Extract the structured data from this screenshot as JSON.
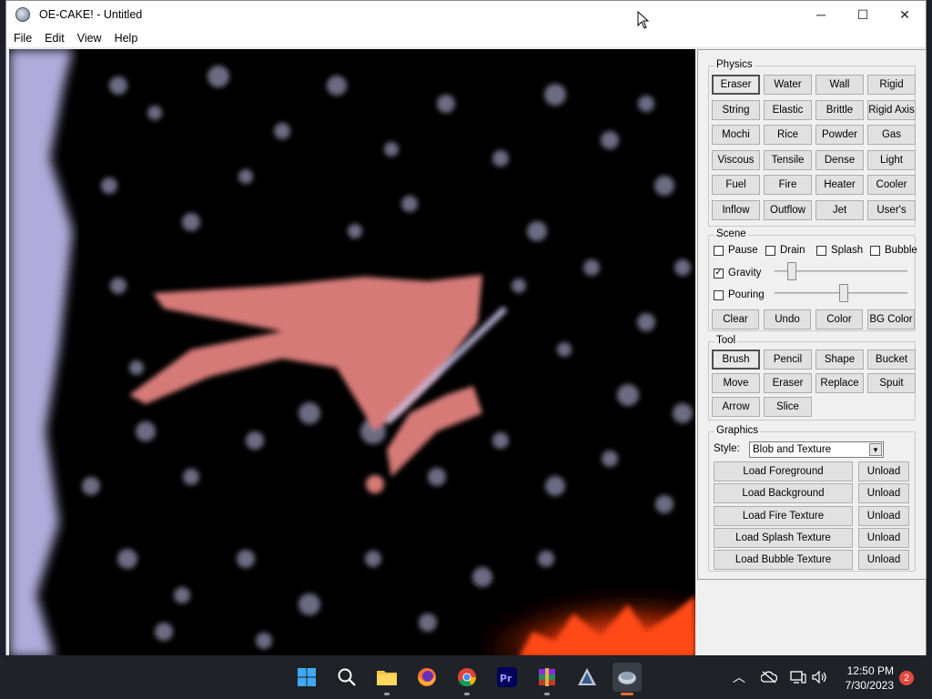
{
  "window": {
    "title": "OE-CAKE! - Untitled"
  },
  "menu": [
    "File",
    "Edit",
    "View",
    "Help"
  ],
  "physics": {
    "title": "Physics",
    "buttons": [
      "Eraser",
      "Water",
      "Wall",
      "Rigid",
      "String",
      "Elastic",
      "Brittle",
      "Rigid Axis",
      "Mochi",
      "Rice",
      "Powder",
      "Gas",
      "Viscous",
      "Tensile",
      "Dense",
      "Light",
      "Fuel",
      "Fire",
      "Heater",
      "Cooler",
      "Inflow",
      "Outflow",
      "Jet",
      "User's"
    ],
    "selected": "Eraser"
  },
  "scene": {
    "title": "Scene",
    "checks": {
      "pause": "Pause",
      "drain": "Drain",
      "splash": "Splash",
      "bubble": "Bubble"
    },
    "gravity": {
      "label": "Gravity",
      "checked": true,
      "level": 0.1
    },
    "pouring": {
      "label": "Pouring",
      "checked": false,
      "level": 0.52
    },
    "buttons": [
      "Clear",
      "Undo",
      "Color",
      "BG Color"
    ]
  },
  "tool": {
    "title": "Tool",
    "buttons": [
      "Brush",
      "Pencil",
      "Shape",
      "Bucket",
      "Move",
      "Eraser",
      "Replace",
      "Spuit",
      "Arrow",
      "Slice"
    ],
    "selected": "Brush"
  },
  "graphics": {
    "title": "Graphics",
    "style_label": "Style:",
    "style_value": "Blob and Texture",
    "loads": [
      "Load Foreground",
      "Load Background",
      "Load Fire Texture",
      "Load Splash Texture",
      "Load Bubble Texture"
    ],
    "unload": "Unload"
  },
  "taskbar": {
    "time": "12:50 PM",
    "date": "7/30/2023",
    "notifications": "2",
    "icons": [
      "windows-start-icon",
      "search-icon",
      "file-explorer-icon",
      "firefox-icon",
      "chrome-icon",
      "premiere-pro-icon",
      "winrar-icon",
      "inkscape-icon",
      "oe-cake-icon"
    ]
  }
}
